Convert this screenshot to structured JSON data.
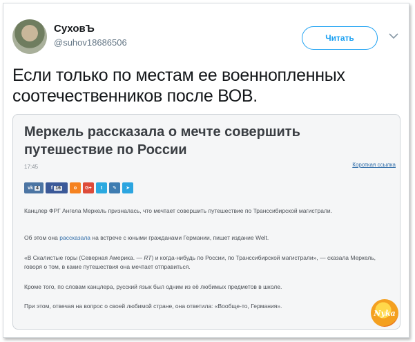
{
  "author": {
    "display_name": "СуховЪ",
    "handle": "@suhov18686506"
  },
  "follow_button": "Читать",
  "tweet_text": "Если только по местам ее военнопленных соотечественников после ВОВ.",
  "article": {
    "title": "Меркель рассказала о мечте совершить путешествие по России",
    "time": "17:45",
    "short_link": "Короткая ссылка",
    "share": [
      {
        "icon": "vk-icon",
        "color": "#4c75a3",
        "count": "4"
      },
      {
        "icon": "facebook-icon",
        "color": "#3b5998",
        "count": "16"
      },
      {
        "icon": "odnoklassniki-icon",
        "color": "#f58220",
        "count": ""
      },
      {
        "icon": "google-plus-icon",
        "color": "#dd4b39",
        "count": ""
      },
      {
        "icon": "twitter-icon",
        "color": "#2aa9e0",
        "count": ""
      },
      {
        "icon": "livejournal-icon",
        "color": "#3e7cb1",
        "count": ""
      },
      {
        "icon": "telegram-icon",
        "color": "#2ca5e0",
        "count": ""
      }
    ],
    "p1": "Канцлер ФРГ Ангела Меркель призналась, что мечтает совершить путешествие по Транссибирской магистрали.",
    "p2_before": "Об этом она ",
    "p2_link": "рассказала",
    "p2_after": " на встрече с юными гражданами Германии, пишет издание Welt.",
    "p3_before": "«В Скалистые горы (Северная Америка. — ",
    "p3_em": "RT",
    "p3_after": ") и когда-нибудь по России, по Транссибирской магистрали», — сказала Меркель, говоря о том, в какие путешествия она мечтает отправиться.",
    "p4": "Кроме того, по словам канцлера, русский язык был одним из её любимых предметов в школе.",
    "p5": "При этом, отвечая на вопрос о своей любимой стране, она ответила: «Вообще-то, Германия».",
    "watermark": "Nyka"
  }
}
